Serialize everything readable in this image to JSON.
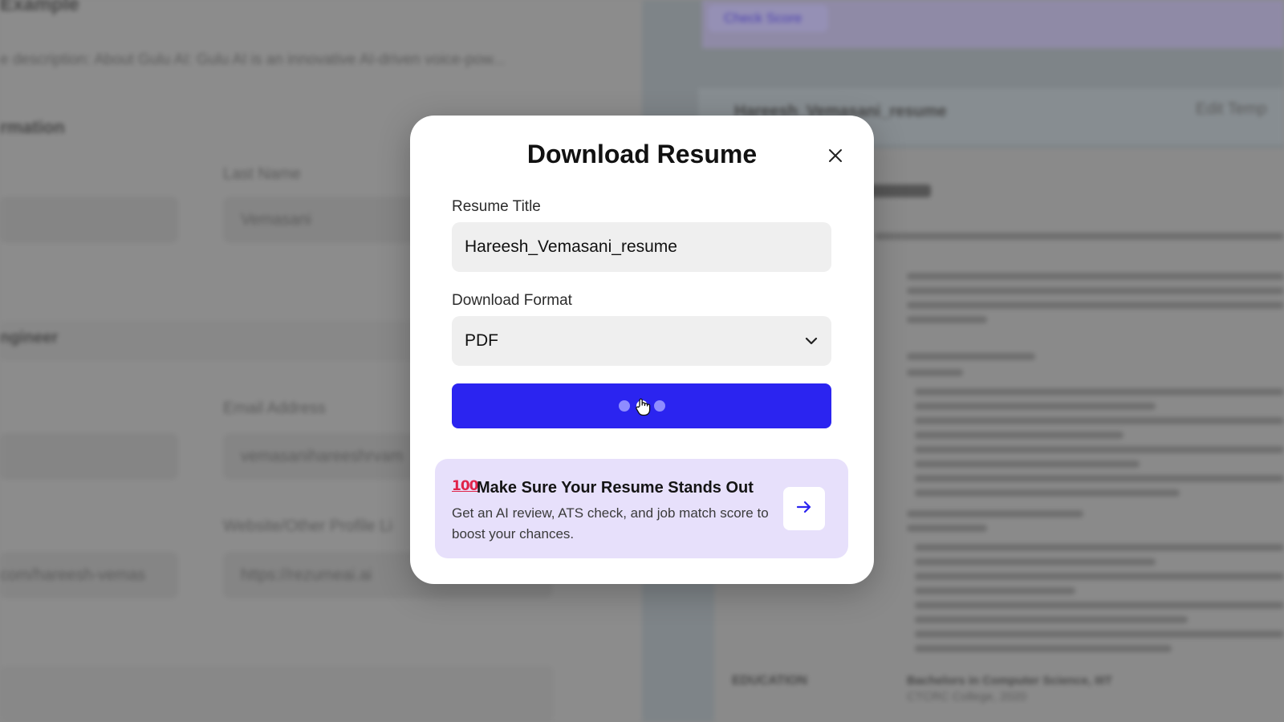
{
  "background": {
    "left_heading_top": "Example",
    "description_snippet": "e description: About Gulu AI: Gulu AI is an innovative AI-driven voice-pow...",
    "section_information": "rmation",
    "last_name_label": "Last Name",
    "last_name_value": "Vemasani",
    "section_engineer": "ngineer",
    "email_label": "Email Address",
    "email_value": "vemasanihareeshrvam",
    "website_label": "Website/Other Profile Li",
    "website_left_value": "com/hareesh-vemas",
    "website_value": "https://rezumeai.ai",
    "check_score_label": "Check Score",
    "resume_filename": "Hareesh_Vemasani_resume",
    "edit_template_label": "Edit Temp",
    "education_label": "EDUCATION",
    "education_school": "Bachelors in Computer Science, IIIT",
    "education_detail": "CTCRC College, 2020"
  },
  "modal": {
    "title": "Download Resume",
    "resume_title_label": "Resume Title",
    "resume_title_value": "Hareesh_Vemasani_resume",
    "download_format_label": "Download Format",
    "download_format_value": "PDF",
    "download_button_state": "loading"
  },
  "promo": {
    "emoji": "100",
    "title": "Make Sure Your Resume Stands Out",
    "description": "Get an AI review, ATS check, and job match score to boost your chances."
  },
  "colors": {
    "accent_button": "#2b24f0",
    "promo_background": "#e7e0fb",
    "overlay": "#8a8a8a"
  },
  "icons": {
    "close": "close-icon",
    "dropdown": "chevron-down-icon",
    "promo_arrow": "arrow-right-icon",
    "promo_emoji": "hundred-points-icon",
    "cursor": "hand-cursor-icon"
  }
}
